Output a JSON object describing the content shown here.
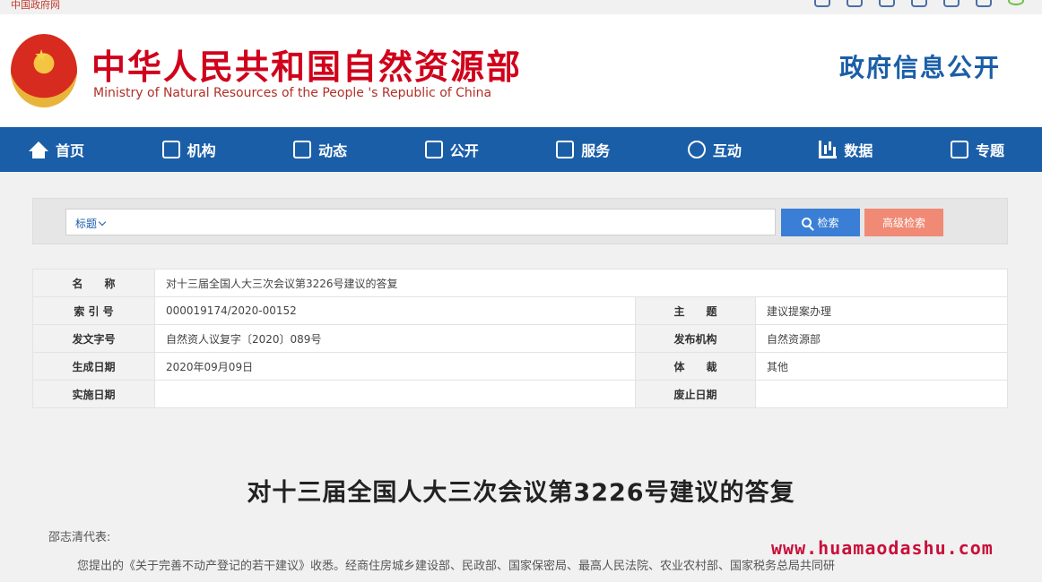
{
  "topbar": {
    "gov_net": "中国政府网"
  },
  "header": {
    "title": "中华人民共和国自然资源部",
    "subtitle": "Ministry of Natural Resources of the People 's Republic of China",
    "gov_info": "政府信息公开"
  },
  "nav": {
    "items": [
      {
        "label": "首页",
        "icon": "home-icon"
      },
      {
        "label": "机构",
        "icon": "organization-icon"
      },
      {
        "label": "动态",
        "icon": "news-icon"
      },
      {
        "label": "公开",
        "icon": "monitor-icon"
      },
      {
        "label": "服务",
        "icon": "service-icon"
      },
      {
        "label": "互动",
        "icon": "chat-icon"
      },
      {
        "label": "数据",
        "icon": "chart-icon"
      },
      {
        "label": "专题",
        "icon": "topic-icon"
      }
    ]
  },
  "search": {
    "type_label": "标题",
    "search_button": "检索",
    "advanced_button": "高级检索"
  },
  "info": {
    "name_label": "名　　称",
    "name_value": "对十三届全国人大三次会议第3226号建议的答复",
    "index_label": "索 引 号",
    "index_value": "000019174/2020-00152",
    "subject_label": "主　　题",
    "subject_value": "建议提案办理",
    "doc_no_label": "发文字号",
    "doc_no_value": "自然资人议复字〔2020〕089号",
    "publisher_label": "发布机构",
    "publisher_value": "自然资源部",
    "date_label": "生成日期",
    "date_value": "2020年09月09日",
    "genre_label": "体　　裁",
    "genre_value": "其他",
    "effective_label": "实施日期",
    "effective_value": "",
    "expiry_label": "废止日期",
    "expiry_value": ""
  },
  "document": {
    "title": "对十三届全国人大三次会议第3226号建议的答复",
    "salutation": "邵志清代表:",
    "body_line": "您提出的《关于完善不动产登记的若干建议》收悉。经商住房城乡建设部、民政部、国家保密局、最高人民法院、农业农村部、国家税务总局共同研"
  },
  "watermark": "www.huamaodashu.com"
}
